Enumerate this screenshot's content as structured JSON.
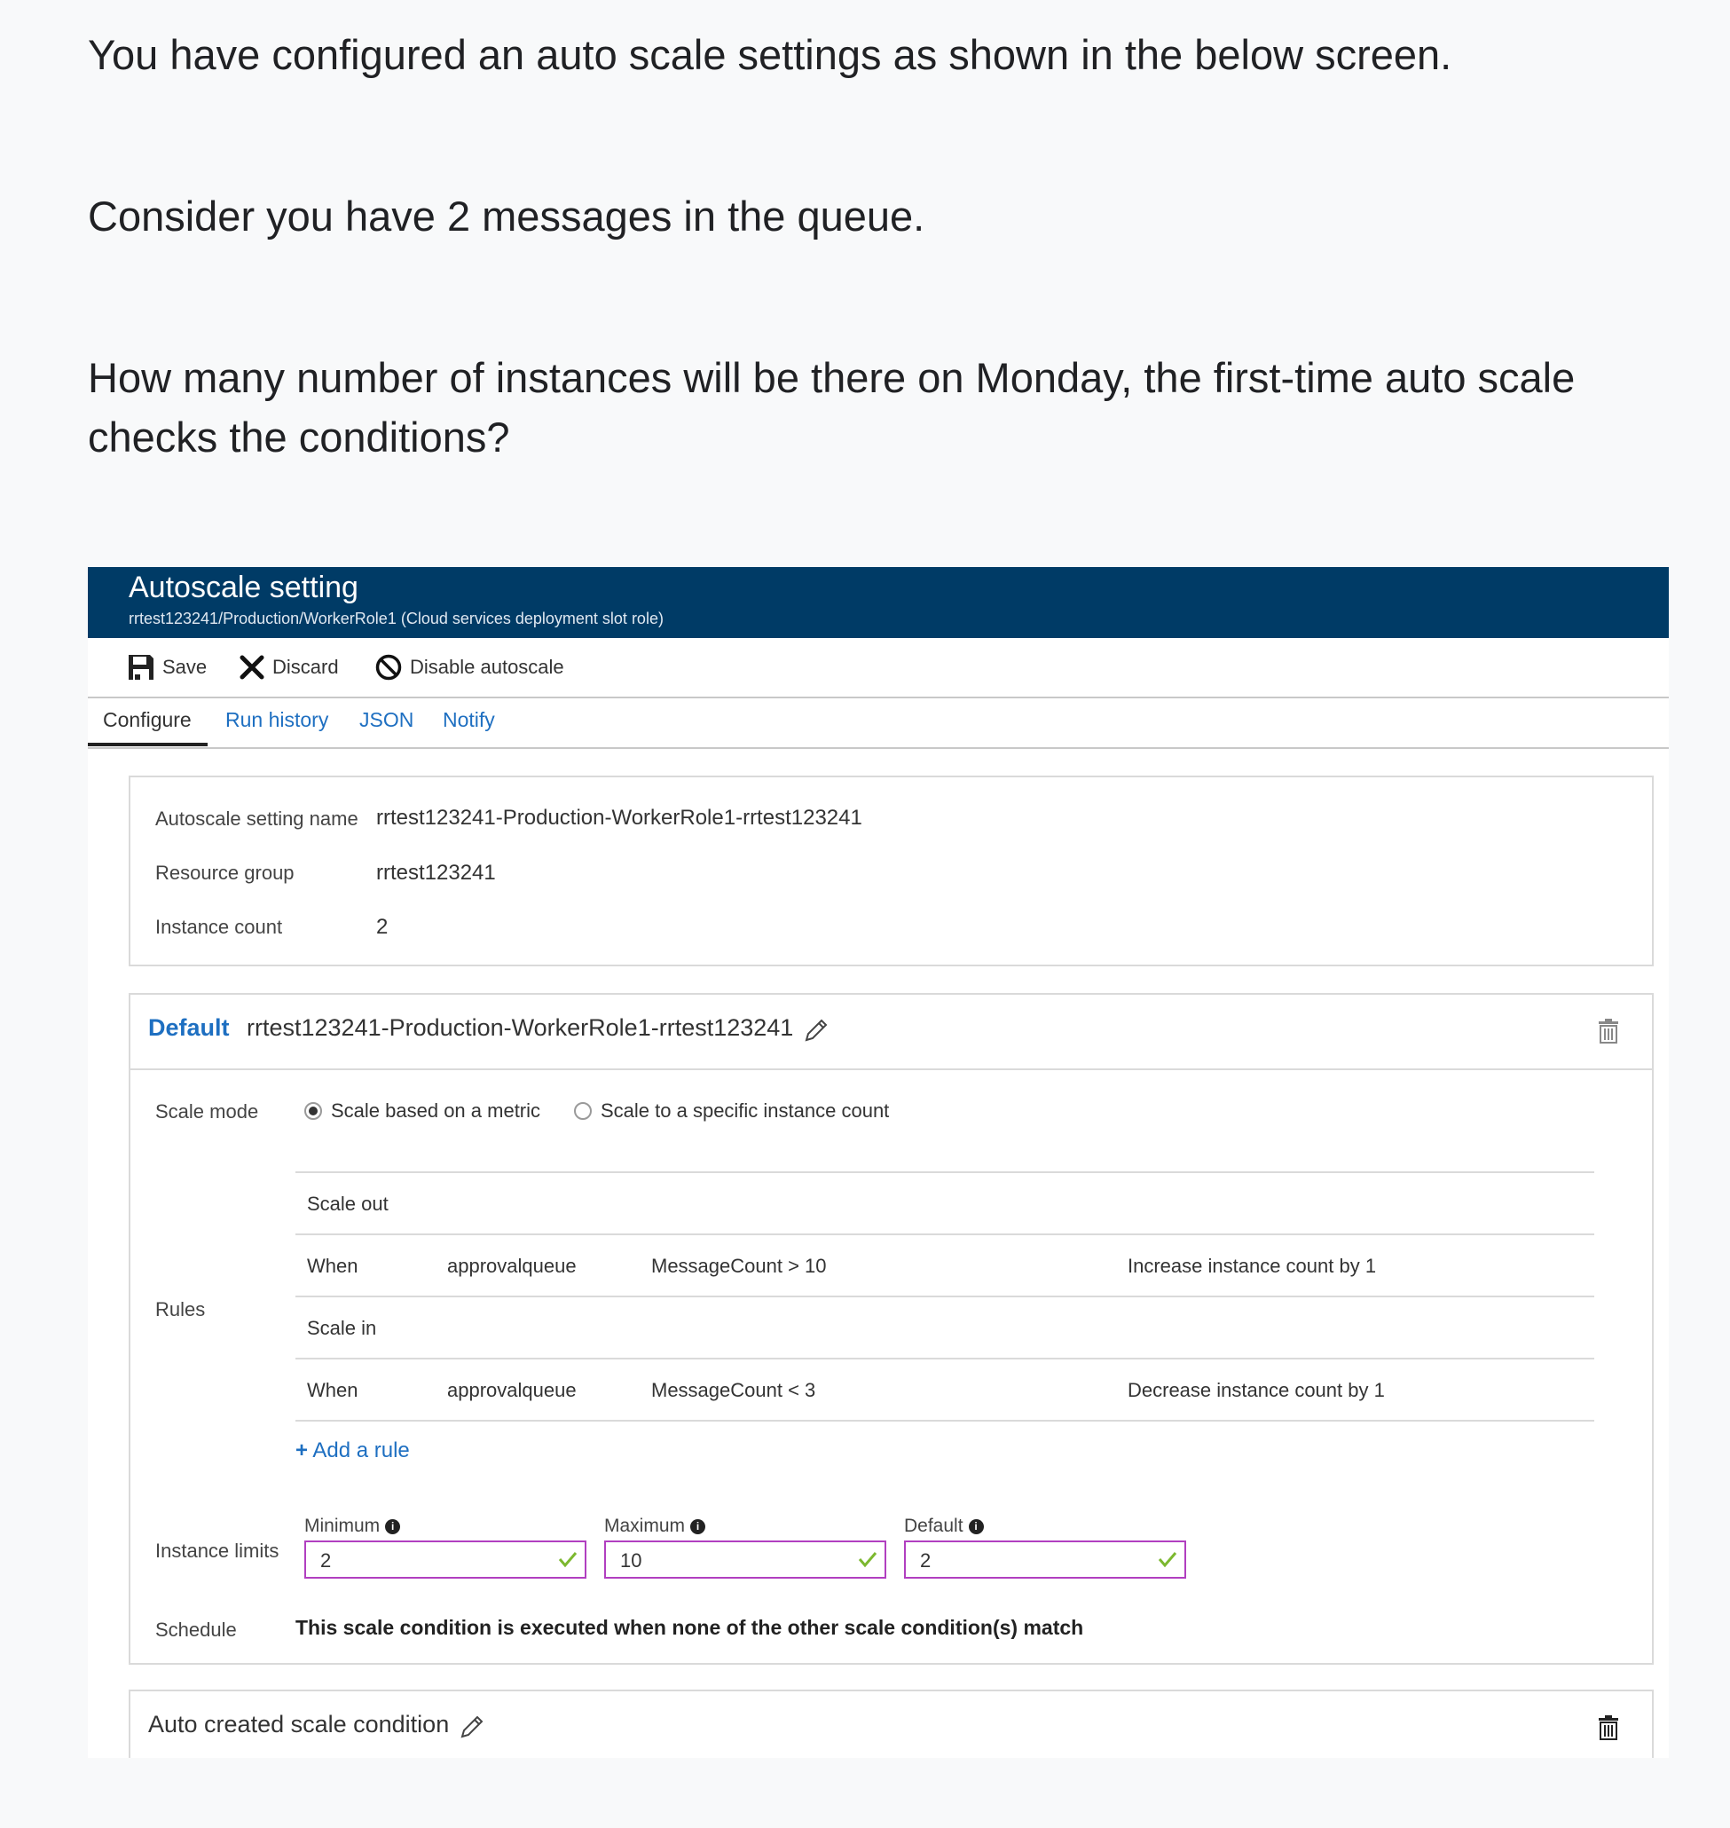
{
  "question": {
    "line1": "You have configured an auto scale settings as shown in the below screen.",
    "line2": "Consider you have 2 messages in the queue.",
    "line3": "How many number of instances will be there on Monday, the first-time auto scale checks the conditions?"
  },
  "header": {
    "title": "Autoscale setting",
    "subtitle": "rrtest123241/Production/WorkerRole1 (Cloud services deployment slot role)"
  },
  "toolbar": {
    "save_label": "Save",
    "discard_label": "Discard",
    "disable_label": "Disable autoscale"
  },
  "tabs": [
    {
      "label": "Configure",
      "active": true
    },
    {
      "label": "Run history"
    },
    {
      "label": "JSON"
    },
    {
      "label": "Notify"
    }
  ],
  "settings": {
    "name_label": "Autoscale setting name",
    "name_value": "rrtest123241-Production-WorkerRole1-rrtest123241",
    "group_label": "Resource group",
    "group_value": "rrtest123241",
    "count_label": "Instance count",
    "count_value": "2"
  },
  "default_condition": {
    "label": "Default",
    "name": "rrtest123241-Production-WorkerRole1-rrtest123241",
    "scale_mode_label": "Scale mode",
    "mode_metric": "Scale based on a metric",
    "mode_specific": "Scale to a specific instance count",
    "selected_mode": "metric",
    "rules_label": "Rules",
    "scale_out_label": "Scale out",
    "scale_out": {
      "when": "When",
      "resource": "approvalqueue",
      "condition": "MessageCount > 10",
      "action": "Increase instance count by 1"
    },
    "scale_in_label": "Scale in",
    "scale_in": {
      "when": "When",
      "resource": "approvalqueue",
      "condition": "MessageCount < 3",
      "action": "Decrease instance count by 1"
    },
    "add_rule": "Add a rule",
    "limits_label": "Instance limits",
    "minimum_label": "Minimum",
    "minimum": "2",
    "maximum_label": "Maximum",
    "maximum": "10",
    "default_label": "Default",
    "default": "2",
    "schedule_label": "Schedule",
    "schedule_text": "This scale condition is executed when none of the other scale condition(s) match"
  },
  "auto_condition": {
    "name": "Auto created scale condition"
  },
  "colors": {
    "header_bg": "#003b66",
    "link": "#1e6fc1",
    "valid_border": "#b13fc0",
    "check": "#7cb82f"
  }
}
